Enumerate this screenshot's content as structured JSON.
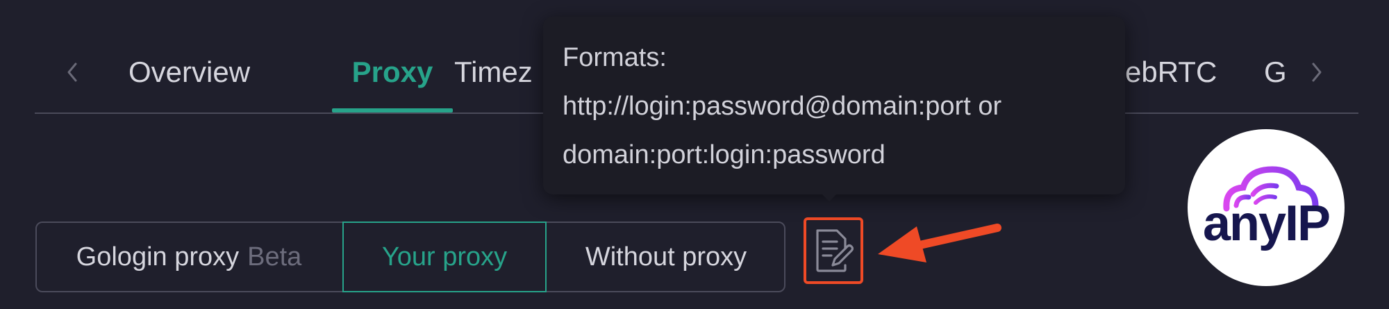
{
  "tabs": {
    "items": [
      {
        "label": "Overview",
        "active": false
      },
      {
        "label": "Proxy",
        "active": true
      },
      {
        "label": "Timez",
        "active": false
      },
      {
        "label": "ebRTC",
        "active": false
      },
      {
        "label": "G",
        "active": false
      }
    ],
    "prev_icon": "chevron-left-icon",
    "next_icon": "chevron-right-icon"
  },
  "tooltip": {
    "lines": [
      "Formats:",
      "http://login:password@domain:port or",
      "domain:port:login:password"
    ]
  },
  "proxy_selector": {
    "options": [
      {
        "label": "Gologin proxy",
        "badge": "Beta",
        "selected": false
      },
      {
        "label": "Your proxy",
        "selected": true
      },
      {
        "label": "Without proxy",
        "selected": false
      }
    ]
  },
  "paste_button": {
    "icon": "edit-document-icon"
  },
  "annotation": {
    "icon": "red-arrow-icon",
    "color": "#ef4a26"
  },
  "logo": {
    "text": "anyIP"
  },
  "colors": {
    "background": "#1f1f2c",
    "accent": "#27a38a",
    "highlight": "#ef4a26",
    "text": "#d6d6de",
    "muted": "#6c6c7c",
    "logo_navy": "#16164e",
    "logo_gradient_start": "#d946ef",
    "logo_gradient_end": "#7c3aed"
  }
}
